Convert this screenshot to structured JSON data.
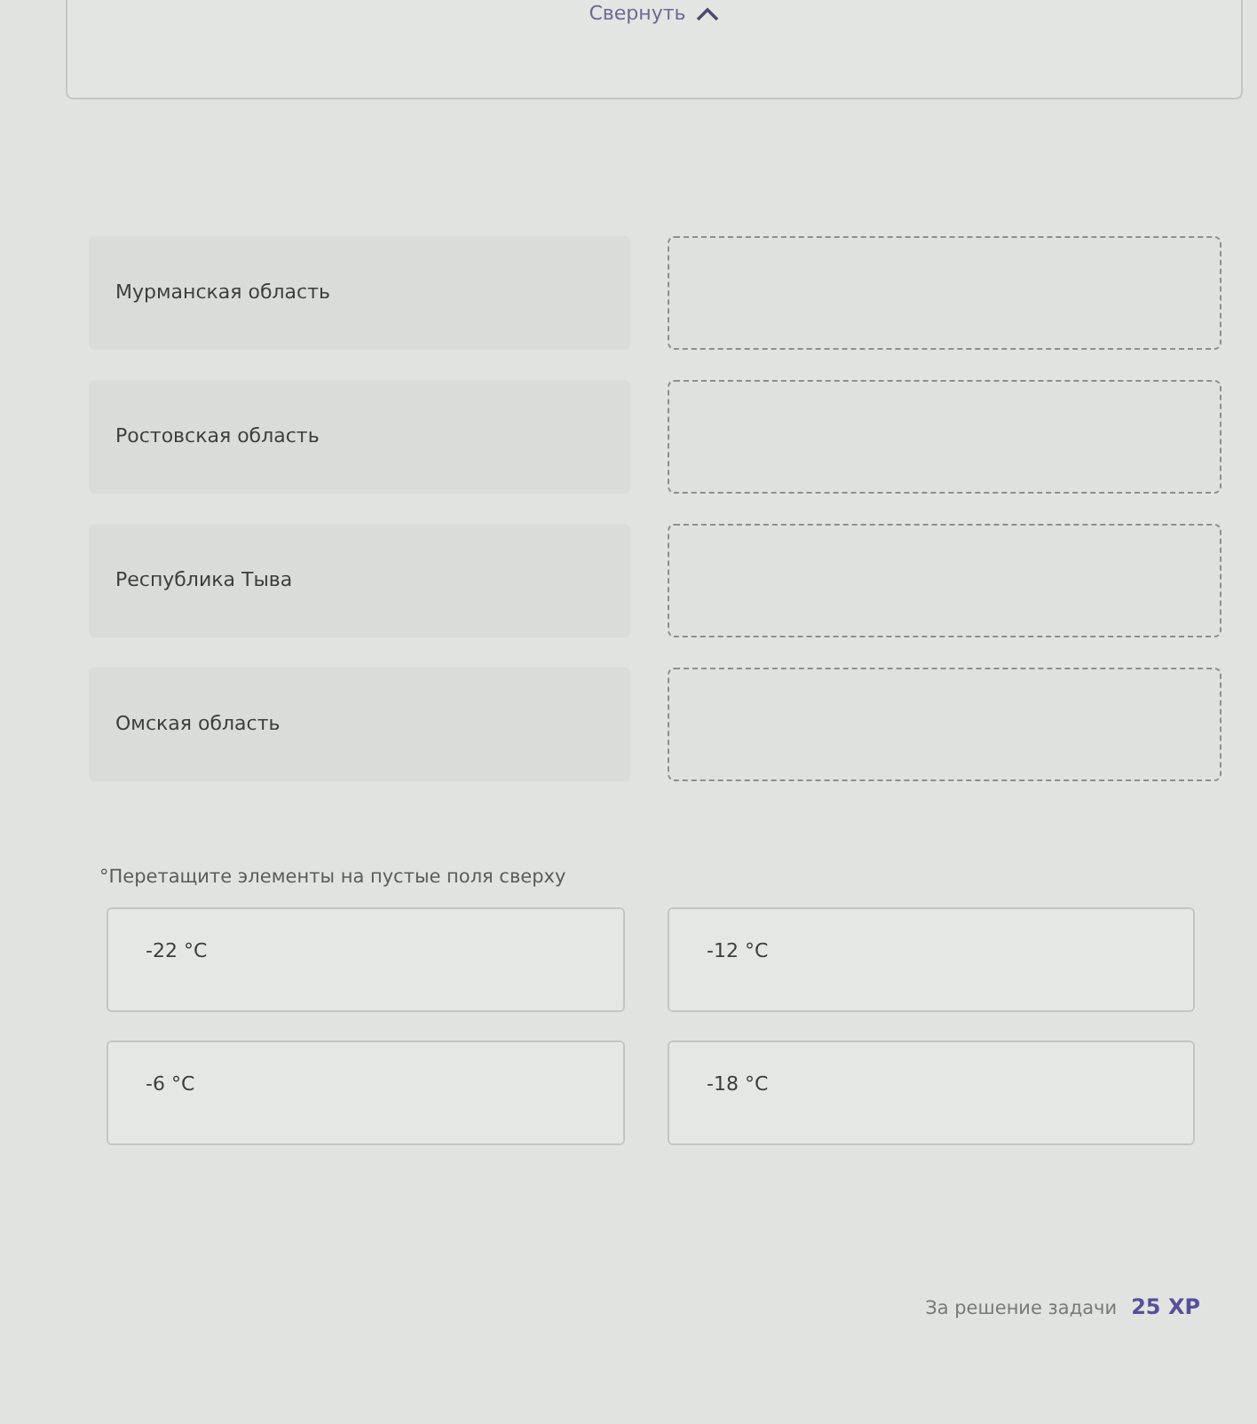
{
  "collapse_button": {
    "label": "Свернуть"
  },
  "matching": {
    "rows": [
      {
        "label": "Мурманская область"
      },
      {
        "label": "Ростовская область"
      },
      {
        "label": "Республика Тыва"
      },
      {
        "label": "Омская область"
      }
    ]
  },
  "hint": "°Перетащите элементы на пустые поля сверху",
  "options": [
    "-22 °C",
    "-12 °C",
    "-6 °C",
    "-18 °C"
  ],
  "reward": {
    "label": "За решение задачи",
    "value": "25 XP"
  }
}
